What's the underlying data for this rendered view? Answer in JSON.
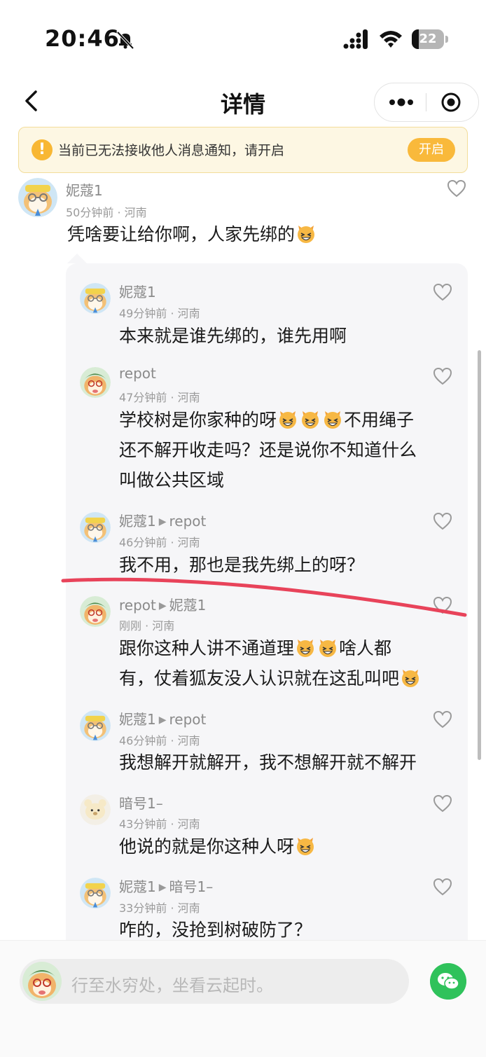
{
  "status_bar": {
    "time": "20:46",
    "battery": "22",
    "battery_level": 0.22
  },
  "nav": {
    "title": "详情"
  },
  "notice": {
    "text": "当前已无法接收他人消息通知，请开启",
    "button": "开启"
  },
  "main_comment": {
    "user": "妮蔻1",
    "meta": "50分钟前 · 河南",
    "text": "凭啥要让给你啊，人家先绑的"
  },
  "replies": [
    {
      "user": "妮蔻1",
      "reply_to": "",
      "meta": "49分钟前 · 河南",
      "lines": [
        "本来就是谁先绑的，谁先用啊"
      ]
    },
    {
      "user": "repot",
      "reply_to": "",
      "meta": "47分钟前 · 河南",
      "lines": [
        "学校树是你家种的呀",
        "不用绳子",
        "还不解开收走吗？还是说你不知道什么",
        "叫做公共区域"
      ]
    },
    {
      "user": "妮蔻1",
      "reply_to": "repot",
      "meta": "46分钟前 · 河南",
      "lines": [
        "我不用，那也是我先绑上的呀？"
      ]
    },
    {
      "user": "repot",
      "reply_to": "妮蔻1",
      "meta": "刚刚 · 河南",
      "lines": [
        "跟你这种人讲不通道理",
        "啥人都",
        "有，仗着狐友没人认识就在这乱叫吧"
      ]
    },
    {
      "user": "妮蔻1",
      "reply_to": "repot",
      "meta": "46分钟前 · 河南",
      "lines": [
        "我想解开就解开，我不想解开就不解开"
      ]
    },
    {
      "user": "暗号1–",
      "reply_to": "",
      "meta": "43分钟前 · 河南",
      "lines": [
        "他说的就是你这种人呀"
      ]
    },
    {
      "user": "妮蔻1",
      "reply_to": "暗号1–",
      "meta": "33分钟前 · 河南",
      "lines": [
        "咋的，没抢到树破防了？"
      ]
    }
  ],
  "input": {
    "placeholder": "行至水穷处，坐看云起时。"
  },
  "colors": {
    "accent": "#f9b93b",
    "notice_bg": "#fdf7e3",
    "wechat": "#2fc25b",
    "annotation": "#e8435a"
  }
}
